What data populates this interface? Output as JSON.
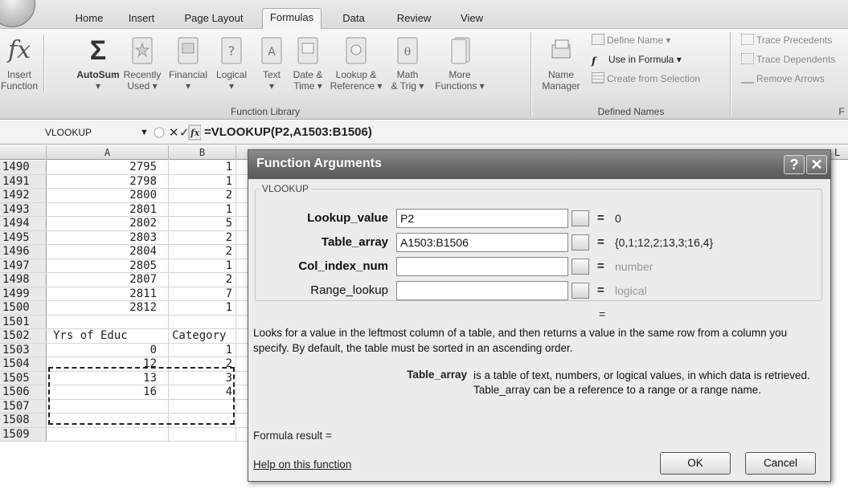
{
  "ribbon": {
    "tabs": [
      "Home",
      "Insert",
      "Page Layout",
      "Formulas",
      "Data",
      "Review",
      "View"
    ],
    "active_tab": "Formulas",
    "function_library": {
      "insert_function": [
        "Insert",
        "Function"
      ],
      "autosum": "AutoSum",
      "recently_used": [
        "Recently",
        "Used"
      ],
      "financial": "Financial",
      "logical": "Logical",
      "text": "Text",
      "date_time": [
        "Date &",
        "Time"
      ],
      "lookup_reference": [
        "Lookup &",
        "Reference"
      ],
      "math_trig": [
        "Math",
        "& Trig"
      ],
      "more_functions": [
        "More",
        "Functions"
      ],
      "group_label": "Function Library"
    },
    "defined_names": {
      "name_manager": [
        "Name",
        "Manager"
      ],
      "define_name": "Define Name",
      "use_in_formula": "Use in Formula",
      "create_from_selection": "Create from Selection",
      "group_label": "Defined Names"
    },
    "formula_auditing": {
      "trace_precedents": "Trace Precedents",
      "trace_dependents": "Trace Dependents",
      "remove_arrows": "Remove Arrows",
      "group_label_partial": "F"
    }
  },
  "formula_bar": {
    "name_box": "VLOOKUP",
    "formula": "=VLOOKUP(P2,A1503:B1506)"
  },
  "sheet": {
    "columns": [
      "A",
      "B",
      "L"
    ],
    "rows": [
      {
        "num": "1490",
        "a": "2795",
        "b": "1"
      },
      {
        "num": "1491",
        "a": "2798",
        "b": "1"
      },
      {
        "num": "1492",
        "a": "2800",
        "b": "2"
      },
      {
        "num": "1493",
        "a": "2801",
        "b": "1"
      },
      {
        "num": "1494",
        "a": "2802",
        "b": "5"
      },
      {
        "num": "1495",
        "a": "2803",
        "b": "2"
      },
      {
        "num": "1496",
        "a": "2804",
        "b": "2"
      },
      {
        "num": "1497",
        "a": "2805",
        "b": "1"
      },
      {
        "num": "1498",
        "a": "2807",
        "b": "2"
      },
      {
        "num": "1499",
        "a": "2811",
        "b": "7"
      },
      {
        "num": "1500",
        "a": "2812",
        "b": "1"
      },
      {
        "num": "1501",
        "a": "",
        "b": ""
      },
      {
        "num": "1502",
        "a": "Yrs of Educ",
        "b": "Category"
      },
      {
        "num": "1503",
        "a": "0",
        "b": "1"
      },
      {
        "num": "1504",
        "a": "12",
        "b": "2"
      },
      {
        "num": "1505",
        "a": "13",
        "b": "3"
      },
      {
        "num": "1506",
        "a": "16",
        "b": "4"
      },
      {
        "num": "1507",
        "a": "",
        "b": ""
      },
      {
        "num": "1508",
        "a": "",
        "b": ""
      },
      {
        "num": "1509",
        "a": "",
        "b": ""
      }
    ]
  },
  "dialog": {
    "title": "Function Arguments",
    "help_button": "?",
    "close_button": "✕",
    "function_name": "VLOOKUP",
    "args": [
      {
        "label": "Lookup_value",
        "value": "P2",
        "result": "0",
        "required": true
      },
      {
        "label": "Table_array",
        "value": "A1503:B1506",
        "result": "{0,1;12,2;13,3;16,4}",
        "required": true
      },
      {
        "label": "Col_index_num",
        "value": "",
        "result": "number",
        "required": true
      },
      {
        "label": "Range_lookup",
        "value": "",
        "result": "logical",
        "required": false
      }
    ],
    "result_eq": "=",
    "description": "Looks for a value in the leftmost column of a table, and then returns a value in the same row from a column you specify. By default, the table must be sorted in an ascending order.",
    "arg_desc_name": "Table_array",
    "arg_desc_text": "is a table of text, numbers, or logical values, in which data is retrieved. Table_array can be a reference to a range or a range name.",
    "formula_result": "Formula result =",
    "help_link": "Help on this function",
    "ok": "OK",
    "cancel": "Cancel"
  }
}
